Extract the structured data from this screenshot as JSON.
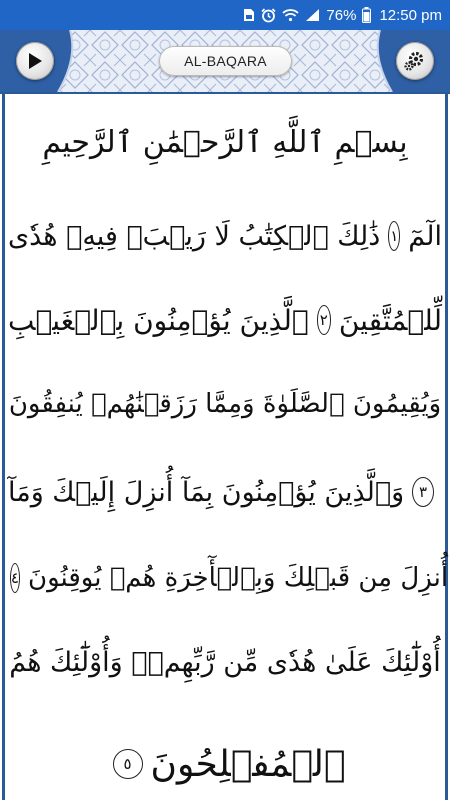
{
  "status_bar": {
    "battery_percent": "76%",
    "time": "12:50 pm",
    "icons": [
      "sim-icon",
      "alarm-icon",
      "wifi-icon",
      "signal-icon",
      "battery-icon"
    ]
  },
  "header": {
    "title": "AL-BAQARA",
    "left_button_icon": "play-icon",
    "right_button_icon": "gear-icon"
  },
  "page": {
    "basmala": "بِسۡمِ ٱللَّهِ ٱلرَّحۡمَٰنِ ٱلرَّحِيمِ",
    "lines": [
      [
        {
          "type": "text",
          "value": "الٓمٓ"
        },
        {
          "type": "marker",
          "value": "١"
        },
        {
          "type": "text",
          "value": "ذَٰلِكَ ٱلۡكِتَٰبُ لَا رَيۡبَۛ فِيهِۛ هُدٗى"
        }
      ],
      [
        {
          "type": "text",
          "value": "لِّلۡمُتَّقِينَ"
        },
        {
          "type": "marker",
          "value": "٢"
        },
        {
          "type": "text",
          "value": "ٱلَّذِينَ يُؤۡمِنُونَ بِٱلۡغَيۡبِ"
        }
      ],
      [
        {
          "type": "text",
          "value": "وَيُقِيمُونَ ٱلصَّلَوٰةَ وَمِمَّا رَزَقۡنَٰهُمۡ يُنفِقُونَ"
        }
      ],
      [
        {
          "type": "marker",
          "value": "٣"
        },
        {
          "type": "text",
          "value": "وَٱلَّذِينَ يُؤۡمِنُونَ بِمَآ أُنزِلَ إِلَيۡكَ وَمَآ"
        }
      ],
      [
        {
          "type": "text",
          "value": "أُنزِلَ مِن قَبۡلِكَ وَبِٱلۡأٓخِرَةِ هُمۡ يُوقِنُونَ"
        },
        {
          "type": "marker",
          "value": "٤"
        }
      ],
      [
        {
          "type": "text",
          "value": "أُوْلَٰٓئِكَ عَلَىٰ هُدٗى مِّن رَّبِّهِمۡۖ وَأُوْلَٰٓئِكَ هُمُ"
        }
      ],
      [
        {
          "type": "text",
          "value": "ٱلۡمُفۡلِحُونَ"
        },
        {
          "type": "marker",
          "value": "٥"
        }
      ]
    ]
  }
}
